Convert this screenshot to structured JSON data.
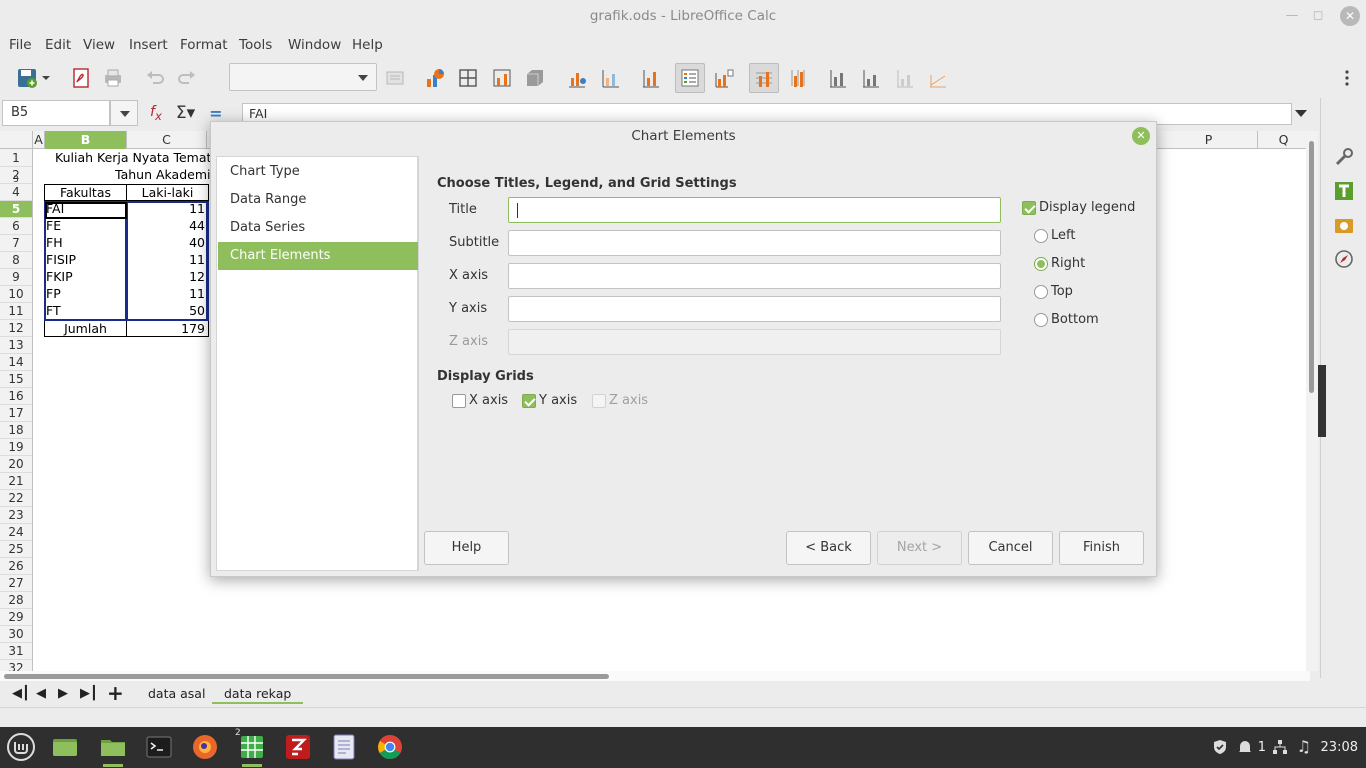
{
  "window": {
    "title": "grafik.ods - LibreOffice Calc"
  },
  "menu": [
    "File",
    "Edit",
    "View",
    "Insert",
    "Format",
    "Tools",
    "Window",
    "Help"
  ],
  "formula_bar": {
    "cell_ref": "B5",
    "content": "FAI"
  },
  "sheet": {
    "columns": [
      "A",
      "B",
      "C",
      "P",
      "Q"
    ],
    "selected_column": "B",
    "rows": [
      "1",
      "2",
      "3",
      "4",
      "5",
      "6",
      "7",
      "8",
      "9",
      "10",
      "11",
      "12",
      "13",
      "14",
      "15",
      "16",
      "17",
      "18",
      "19",
      "20",
      "21",
      "22",
      "23",
      "24",
      "25",
      "26",
      "27",
      "28",
      "29",
      "30",
      "31",
      "32"
    ],
    "selected_row": "5",
    "title_line1": "Kuliah Kerja Nyata Tematik",
    "title_line2": "Tahun Akademik",
    "table": {
      "headers": [
        "Fakultas",
        "Laki-laki"
      ],
      "rows": [
        [
          "FAI",
          "11"
        ],
        [
          "FE",
          "44"
        ],
        [
          "FH",
          "40"
        ],
        [
          "FISIP",
          "11"
        ],
        [
          "FKIP",
          "12"
        ],
        [
          "FP",
          "11"
        ],
        [
          "FT",
          "50"
        ]
      ],
      "total": [
        "Jumlah",
        "179"
      ]
    },
    "tabs": [
      "data asal",
      "data rekap"
    ],
    "active_tab": "data rekap"
  },
  "dialog": {
    "title": "Chart Elements",
    "steps": [
      "Chart Type",
      "Data Range",
      "Data Series",
      "Chart Elements"
    ],
    "active_step": "Chart Elements",
    "section_titles": "Choose Titles, Legend, and Grid Settings",
    "fields": {
      "title": {
        "label": "Title",
        "value": ""
      },
      "subtitle": {
        "label": "Subtitle",
        "value": ""
      },
      "x_axis": {
        "label": "X axis",
        "value": ""
      },
      "y_axis": {
        "label": "Y axis",
        "value": ""
      },
      "z_axis": {
        "label": "Z axis",
        "value": "",
        "disabled": true
      }
    },
    "legend": {
      "display_label": "Display legend",
      "display": true,
      "positions": [
        "Left",
        "Right",
        "Top",
        "Bottom"
      ],
      "selected": "Right"
    },
    "grids": {
      "section_title": "Display Grids",
      "x_axis": {
        "label": "X axis",
        "checked": false
      },
      "y_axis": {
        "label": "Y axis",
        "checked": true
      },
      "z_axis": {
        "label": "Z axis",
        "checked": false,
        "disabled": true
      }
    },
    "buttons": {
      "help": "Help",
      "back": "< Back",
      "next": "Next >",
      "cancel": "Cancel",
      "finish": "Finish"
    }
  },
  "taskbar": {
    "calc_badge": "2",
    "tray_count": "1",
    "clock": "23:08"
  },
  "colors": {
    "accent": "#8fbf5c",
    "taskbar": "#2f2f2f"
  }
}
